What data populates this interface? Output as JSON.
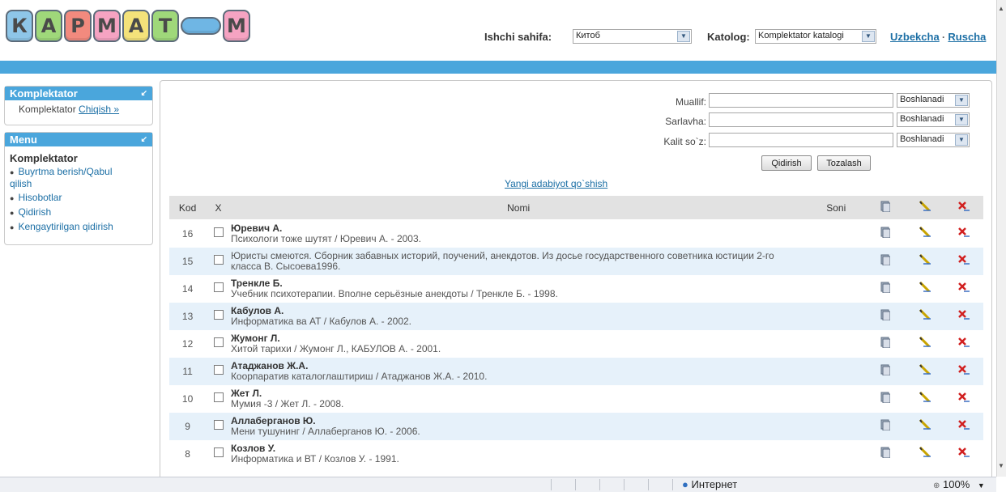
{
  "logo": {
    "letters": [
      "К",
      "А",
      "Р",
      "М",
      "А",
      "Т",
      "",
      "М"
    ],
    "colors": [
      "#8ec6e8",
      "#9fd87a",
      "#f28a7e",
      "#f5a3c2",
      "#f4e27a",
      "#9fd87a",
      "#6fb6e4",
      "#f5a3c2"
    ]
  },
  "header": {
    "workpage_label": "Ishchi sahifa:",
    "workpage_value": "Китоб",
    "catalog_label": "Katolog:",
    "catalog_value": "Komplektator katalogi",
    "lang_uz": "Uzbekcha",
    "lang_sep": "·",
    "lang_ru": "Ruscha"
  },
  "sidebar": {
    "panel1_title": "Komplektator",
    "panel1_user": "Komplektator",
    "panel1_logout": "Chiqish »",
    "panel2_title": "Menu",
    "panel2_heading": "Komplektator",
    "items": [
      {
        "label": "Buyrtma berish/Qabul"
      },
      {
        "label": "qilish"
      },
      {
        "label": "Hisobotlar"
      },
      {
        "label": "Qidirish"
      },
      {
        "label": "Kengaytirilgan qidirish"
      }
    ]
  },
  "search": {
    "author_label": "Muallif:",
    "title_label": "Sarlavha:",
    "keyword_label": "Kalit so`z:",
    "mode1": "Boshlanadi",
    "mode2": "Boshlanadi",
    "mode3": "Boshlanadi",
    "search_button": "Qidirish",
    "clear_button": "Tozalash",
    "add_link": "Yangi adabiyot qo`shish"
  },
  "table": {
    "headers": {
      "kod": "Kod",
      "x": "X",
      "nomi": "Nomi",
      "soni": "Soni"
    },
    "rows": [
      {
        "kod": "16",
        "author": "Юревич А.",
        "title": "Психологи тоже шутят / Юревич А. - 2003."
      },
      {
        "kod": "15",
        "author": "",
        "title": "Юристы смеются. Сборник забавных историй, поучений, анекдотов. Из досье государственного советника юстиции 2-го класса В. Сысоева1996."
      },
      {
        "kod": "14",
        "author": "Тренкле Б.",
        "title": "Учебник психотерапии. Вполне серьёзные анекдоты / Тренкле Б. - 1998."
      },
      {
        "kod": "13",
        "author": "Кабулов А.",
        "title": "Информатика ва АТ / Кабулов А. - 2002."
      },
      {
        "kod": "12",
        "author": "Жумонг Л.",
        "title": "Хитой тарихи / Жумонг Л., КАБУЛОВ А. - 2001."
      },
      {
        "kod": "11",
        "author": "Атаджанов Ж.А.",
        "title": "Коорпаратив каталоглаштириш / Атаджанов Ж.А. - 2010."
      },
      {
        "kod": "10",
        "author": "Жет Л.",
        "title": "Мумия -3 / Жет Л. - 2008."
      },
      {
        "kod": "9",
        "author": "Аллаберганов Ю.",
        "title": "Мени тушунинг / Аллаберганов Ю. - 2006."
      },
      {
        "kod": "8",
        "author": "Козлов У.",
        "title": "Информатика и ВТ / Козлов У. - 1991."
      }
    ]
  },
  "statusbar": {
    "zone": "Интернет",
    "zoom": "100%"
  }
}
